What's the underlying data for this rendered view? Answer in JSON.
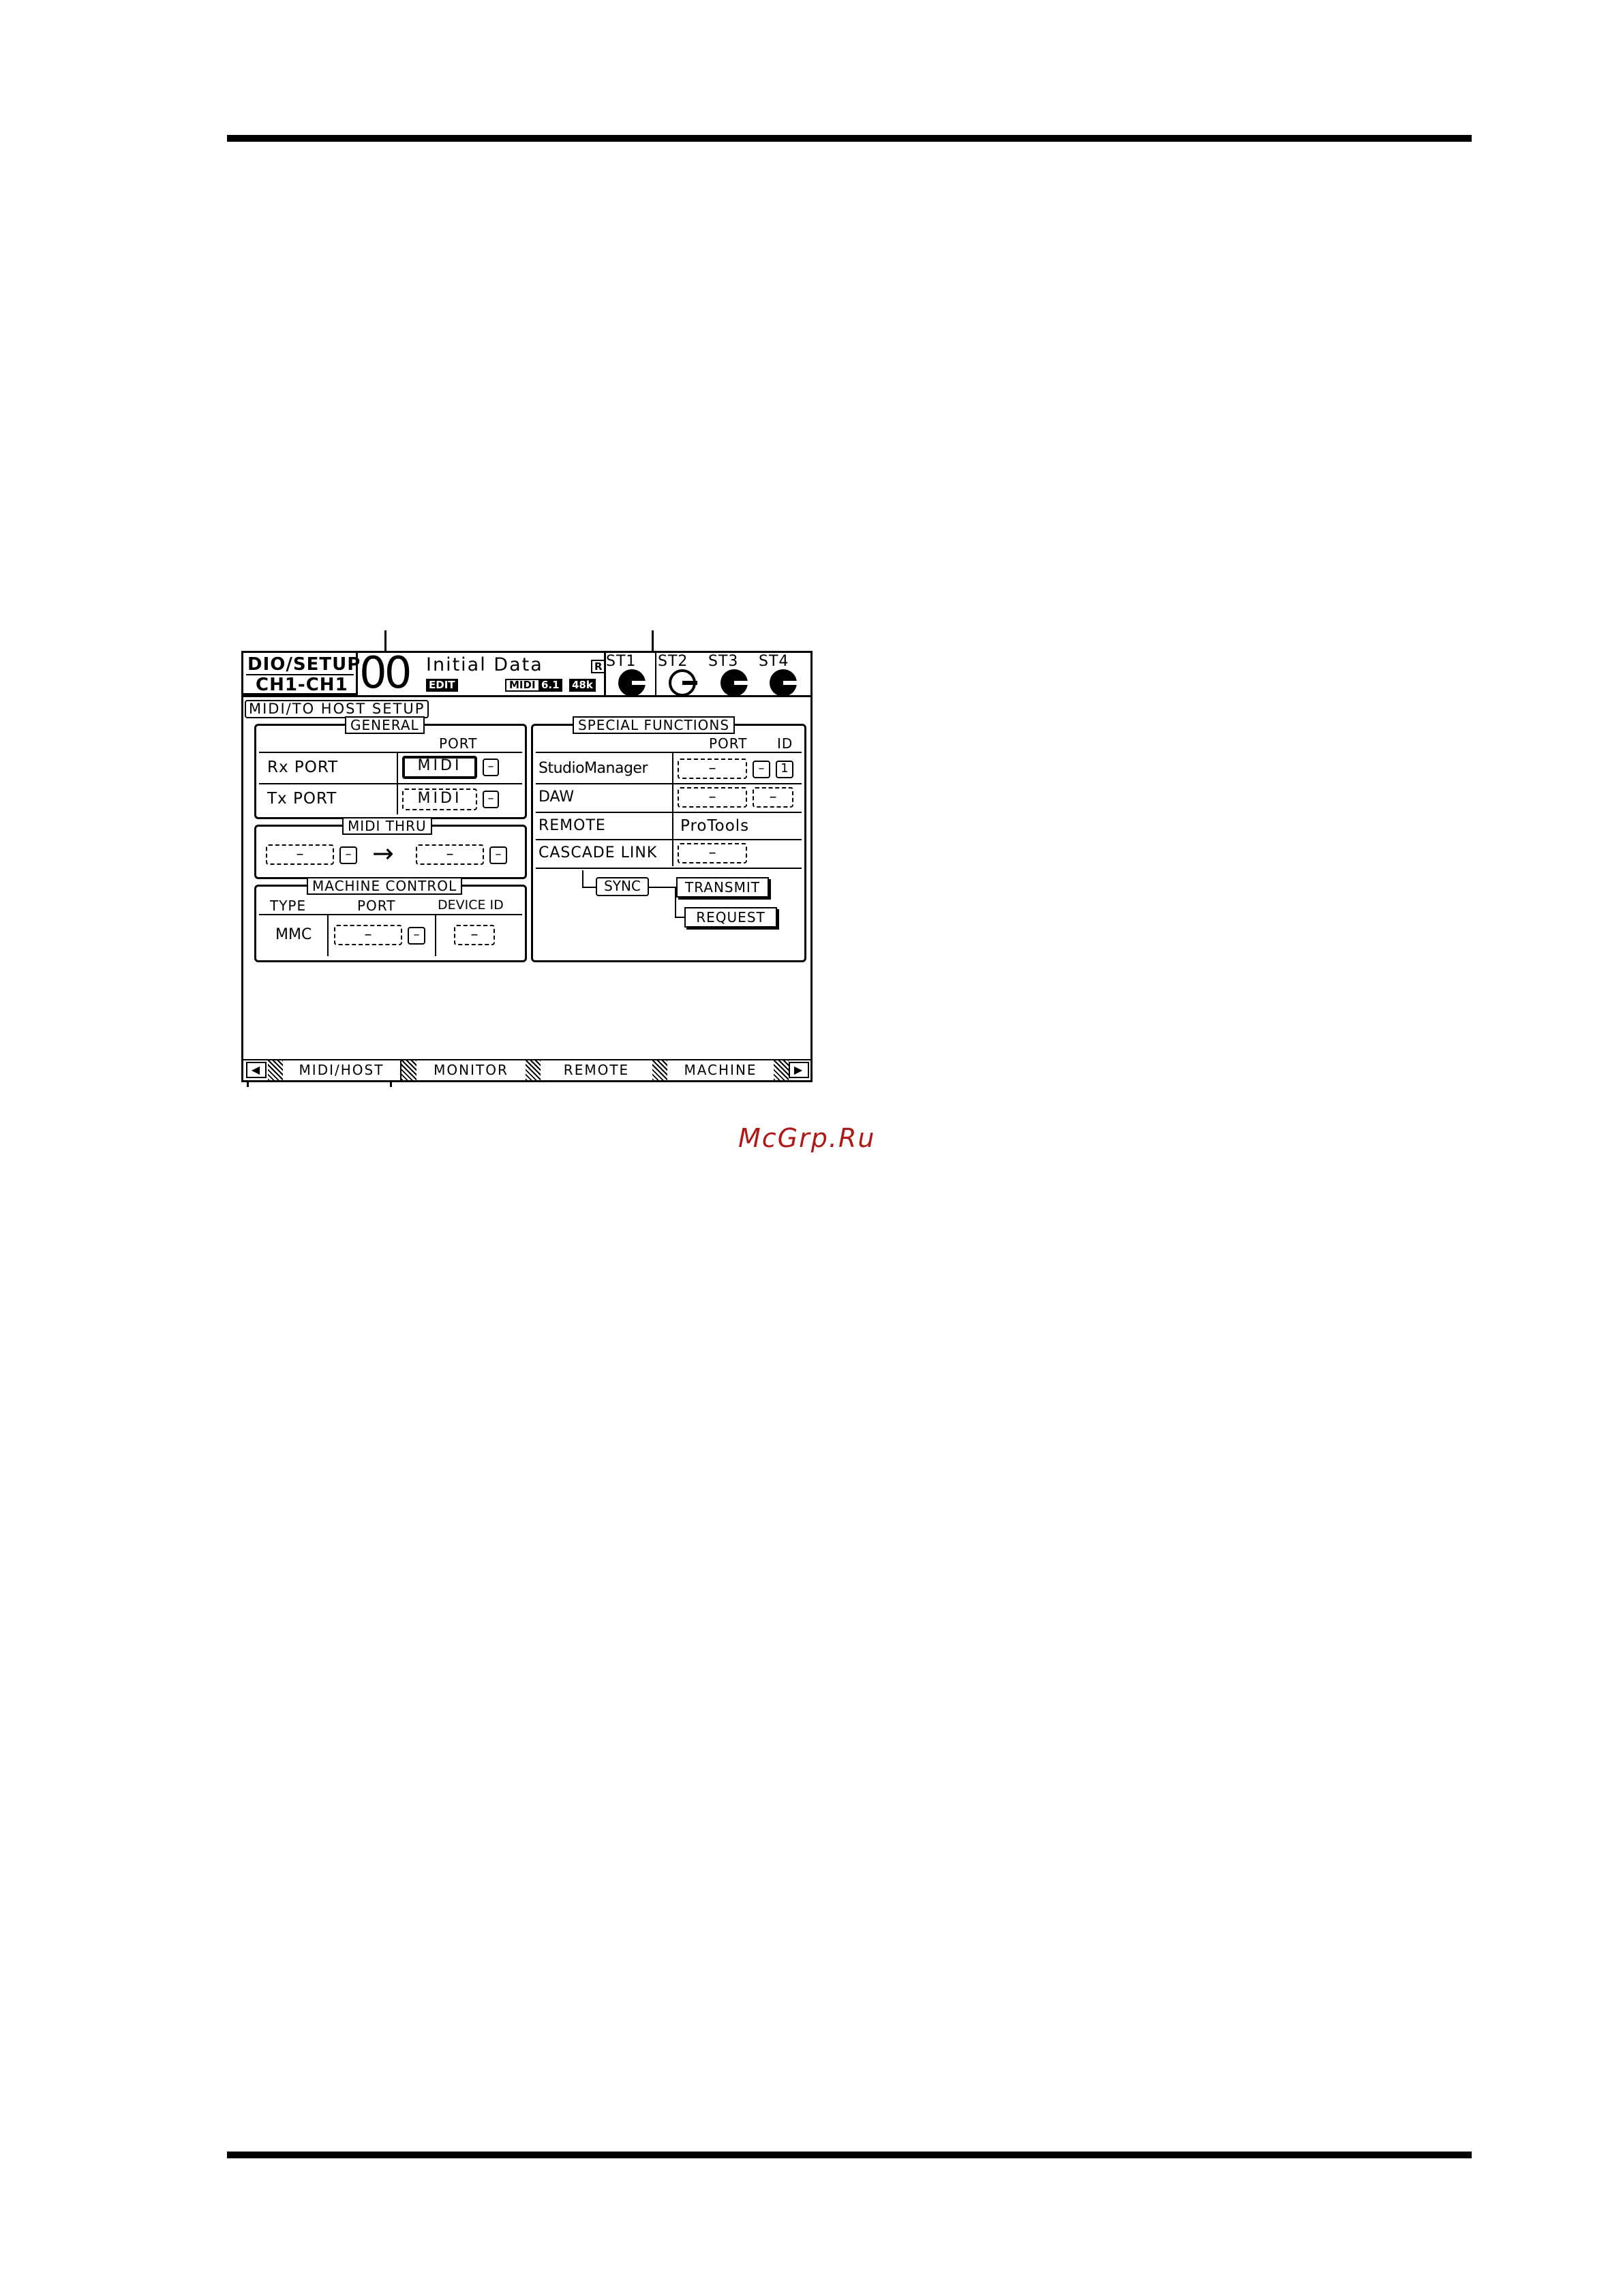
{
  "screen": {
    "title_top": "DIO/SETUP",
    "title_bottom": "CH1-CH1",
    "scene_number": "00",
    "scene_name": "Initial Data",
    "protect_badge": "R",
    "edit_badge": "EDIT",
    "midi_badge": "MIDI",
    "surround_badge": "6.1",
    "fs_badge": "48k",
    "st_labels": [
      "ST1",
      "ST2",
      "ST3",
      "ST4"
    ],
    "page_title": "MIDI/TO HOST SETUP"
  },
  "general": {
    "legend": "GENERAL",
    "port_header": "PORT",
    "rx_label": "Rx PORT",
    "rx_port": "MIDI",
    "rx_sub": "–",
    "tx_label": "Tx PORT",
    "tx_port": "MIDI",
    "tx_sub": "–"
  },
  "midi_thru": {
    "legend": "MIDI THRU",
    "in_port": "–",
    "in_sub": "–",
    "arrow": "→",
    "out_port": "–",
    "out_sub": "–"
  },
  "machine_control": {
    "legend": "MACHINE CONTROL",
    "type_header": "TYPE",
    "port_header": "PORT",
    "device_header": "DEVICE ID",
    "type_value": "MMC",
    "port_value": "–",
    "port_sub": "–",
    "device_value": "–"
  },
  "special": {
    "legend": "SPECIAL FUNCTIONS",
    "port_header": "PORT",
    "id_header": "ID",
    "studio_label": "StudioManager",
    "studio_port": "–",
    "studio_sub": "–",
    "studio_id": "1",
    "daw_label": "DAW",
    "daw_port": "–",
    "daw_sub": "–",
    "remote_label": "REMOTE",
    "remote_value": "ProTools",
    "cascade_label": "CASCADE LINK",
    "cascade_value": "–",
    "sync_label": "SYNC",
    "transmit_label": "TRANSMIT",
    "request_label": "REQUEST"
  },
  "tabs": {
    "left_arrow": "◀",
    "right_arrow": "▶",
    "items": [
      "MIDI/HOST",
      "MONITOR",
      "REMOTE",
      "MACHINE"
    ]
  },
  "watermark": "McGrp.Ru"
}
